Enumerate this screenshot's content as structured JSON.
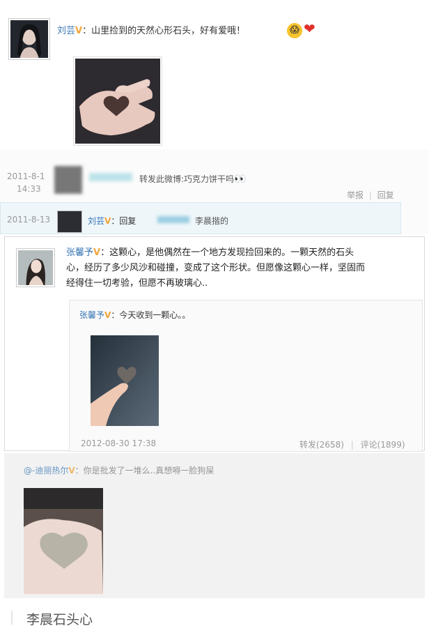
{
  "post1": {
    "author": "刘芸",
    "v_badge": "V",
    "colon": "：",
    "text": "山里捡到的天然心形石头，好有爱哦！",
    "emoji": [
      "😱",
      "❤"
    ]
  },
  "post2": {
    "reply1": {
      "date": "2011-8-1",
      "time": "14:33",
      "text": "转发此微博:巧克力饼干吗",
      "emoji": "👀",
      "actions": [
        "举报",
        "回复"
      ],
      "separator": "|"
    },
    "reply2": {
      "date": "2011-8-13",
      "author": "刘芸",
      "v_badge": "V",
      "colon": "：回复",
      "text": "李晨揩的"
    }
  },
  "post3": {
    "author": "张馨予",
    "v_badge": "V",
    "colon": "：",
    "line1": "这颗心，是他偶然在一个地方发现捡回来的。一颗天然的石头",
    "line2": "心，经历了多少风沙和碰撞，变成了这个形状。但愿像这颗心一样，坚固而",
    "line3": "经得住一切考验，但愿不再玻璃心..",
    "quote": {
      "author": "张馨予",
      "v_badge": "V",
      "text": "：今天收到一颗心。。",
      "timestamp": "2012-08-30 17:38",
      "repost": "转发(2658)",
      "separator": "|",
      "comment": "评论(1899)"
    }
  },
  "post4": {
    "author": "@-迪丽热尔",
    "v_badge": "V",
    "text": "：你是批发了一堆么..真想嘚一脸狗屎"
  },
  "caption": "李晨石头心",
  "colors": {
    "link": "#3a78b6",
    "v_badge": "#f0a43c",
    "border": "#d9d9d9"
  }
}
